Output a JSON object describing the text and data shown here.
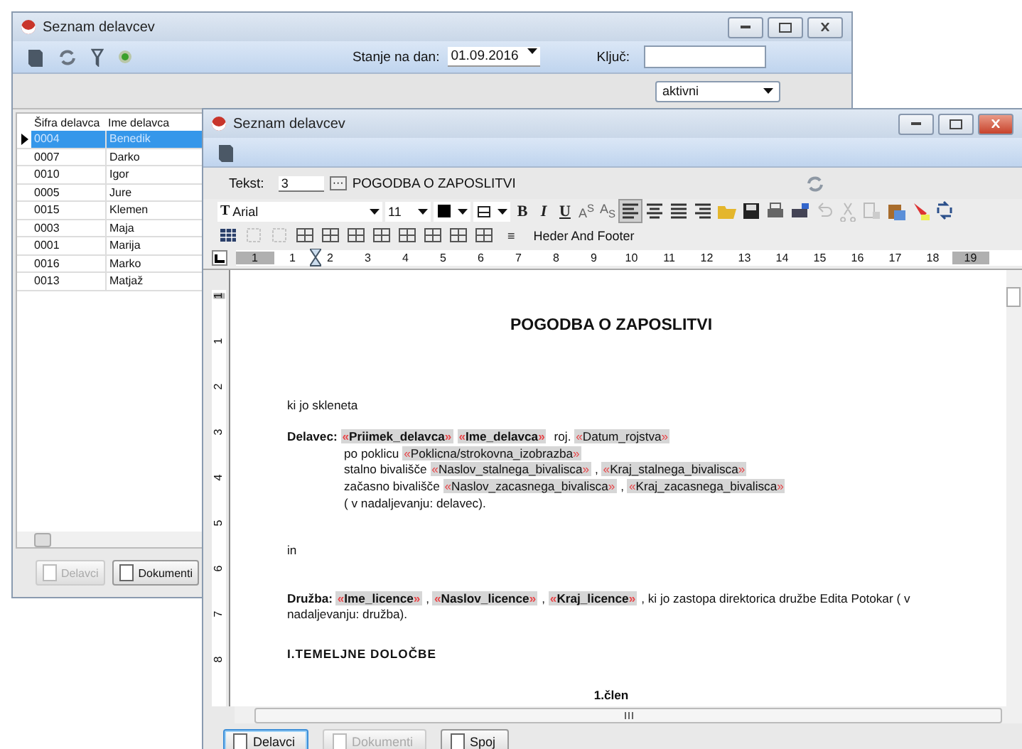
{
  "back_window": {
    "title": "Seznam delavcev",
    "toolbar": {
      "date_label": "Stanje na dan:",
      "date_value": "01.09.2016",
      "key_label": "Ključ:"
    },
    "filter": {
      "value": "aktivni"
    },
    "list": {
      "columns": [
        "Šifra delavca",
        "Ime delavca"
      ],
      "rows": [
        {
          "code": "0004",
          "name": "Benedik",
          "selected": true
        },
        {
          "code": "0007",
          "name": "Darko",
          "selected": false
        },
        {
          "code": "0010",
          "name": "Igor",
          "selected": false
        },
        {
          "code": "0005",
          "name": "Jure",
          "selected": false
        },
        {
          "code": "0015",
          "name": "Klemen",
          "selected": false
        },
        {
          "code": "0003",
          "name": "Maja",
          "selected": false
        },
        {
          "code": "0001",
          "name": "Marija",
          "selected": false
        },
        {
          "code": "0016",
          "name": "Marko",
          "selected": false
        },
        {
          "code": "0013",
          "name": "Matjaž",
          "selected": false
        }
      ]
    },
    "buttons": [
      {
        "label": "Delavci",
        "disabled": true
      },
      {
        "label": "Dokumenti",
        "disabled": false
      }
    ]
  },
  "front_window": {
    "title": "Seznam delavcev",
    "text_row": {
      "label": "Tekst:",
      "number": "3",
      "browse": "···",
      "name": "POGODBA O ZAPOSLITVI"
    },
    "format": {
      "font_glyph": "T",
      "font": "Arial",
      "size": "11",
      "bold": "B",
      "italic": "I",
      "underline": "U",
      "superscript": "A$^{S}$",
      "subscript": "A$_{S}$"
    },
    "table_toolbar": {
      "symbol": "≡",
      "header_footer": "Heder And Footer"
    },
    "ruler": [
      "1",
      "1",
      "2",
      "3",
      "4",
      "5",
      "6",
      "7",
      "8",
      "9",
      "10",
      "11",
      "12",
      "13",
      "14",
      "15",
      "16",
      "17",
      "18",
      "19"
    ],
    "vertical_ruler": [
      "1",
      "1",
      "2",
      "3",
      "4",
      "5",
      "6",
      "7",
      "8"
    ],
    "document": [
      {
        "kind": "title",
        "segments": [
          {
            "kind": "text",
            "text": "POGODBA O ZAPOSLITVI"
          }
        ]
      },
      {
        "kind": "para",
        "segments": [
          {
            "kind": "text",
            "text": "ki jo skleneta"
          }
        ]
      },
      {
        "kind": "para",
        "segments": [
          {
            "kind": "strong",
            "text": "Delavec: "
          },
          {
            "kind": "field",
            "open": "«",
            "name": "Priimek_delavca",
            "close": "»",
            "bold": true
          },
          {
            "kind": "field",
            "open": "«",
            "name": "Ime_delavca",
            "close": "»",
            "bold": true
          },
          {
            "kind": "text",
            "text": "  roj. "
          },
          {
            "kind": "field",
            "open": "«",
            "name": "Datum_rojstva",
            "close": "»",
            "bold": false
          }
        ]
      },
      {
        "kind": "indent",
        "segments": [
          {
            "kind": "text",
            "text": "po poklicu  "
          },
          {
            "kind": "field",
            "open": "«",
            "name": "Poklicna/strokovna_izobrazba",
            "close": "»",
            "bold": false
          }
        ]
      },
      {
        "kind": "indent",
        "segments": [
          {
            "kind": "text",
            "text": "stalno bivališče      "
          },
          {
            "kind": "field",
            "open": "«",
            "name": "Naslov_stalnega_bivalisca",
            "close": "»",
            "bold": false
          },
          {
            "kind": "text",
            "text": ", "
          },
          {
            "kind": "field",
            "open": "«",
            "name": "Kraj_stalnega_bivalisca",
            "close": "»",
            "bold": false
          }
        ]
      },
      {
        "kind": "indent",
        "segments": [
          {
            "kind": "text",
            "text": "začasno bivališče      "
          },
          {
            "kind": "field",
            "open": "«",
            "name": "Naslov_zacasnega_bivalisca",
            "close": "»",
            "bold": false
          },
          {
            "kind": "text",
            "text": ", "
          },
          {
            "kind": "field",
            "open": "«",
            "name": "Kraj_zacasnega_bivalisca",
            "close": "»",
            "bold": false
          }
        ]
      },
      {
        "kind": "indent",
        "segments": [
          {
            "kind": "text",
            "text": "( v nadaljevanju: delavec)."
          }
        ]
      },
      {
        "kind": "spaced",
        "segments": [
          {
            "kind": "text",
            "text": "in"
          }
        ]
      },
      {
        "kind": "spaced",
        "segments": [
          {
            "kind": "strong",
            "text": "Družba:  "
          },
          {
            "kind": "field",
            "open": "«",
            "name": "Ime_licence",
            "close": "»",
            "bold": true
          },
          {
            "kind": "text",
            "text": ", "
          },
          {
            "kind": "field",
            "open": "«",
            "name": "Naslov_licence",
            "close": "»",
            "bold": true
          },
          {
            "kind": "text",
            "text": ", "
          },
          {
            "kind": "field",
            "open": "«",
            "name": "Kraj_licence",
            "close": "»",
            "bold": true
          },
          {
            "kind": "text",
            "text": ", ki jo zastopa direktorica družbe Edita Potokar ( v nadaljevanju: družba)."
          }
        ]
      },
      {
        "kind": "heading",
        "segments": [
          {
            "kind": "text",
            "text": "I.TEMELJNE DOLOČBE"
          }
        ]
      },
      {
        "kind": "center",
        "segments": [
          {
            "kind": "text",
            "text": "1.člen"
          }
        ]
      }
    ],
    "buttons": [
      {
        "label": "Delavci",
        "disabled": false,
        "focused": true
      },
      {
        "label": "Dokumenti",
        "disabled": true,
        "focused": false
      },
      {
        "label": "Spoj",
        "disabled": false,
        "focused": false
      }
    ]
  }
}
